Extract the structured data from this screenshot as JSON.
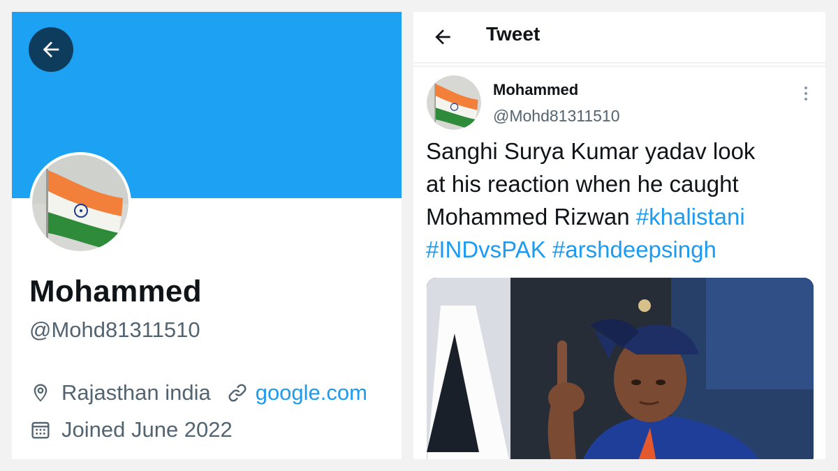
{
  "profile": {
    "display_name": "Mohammed",
    "handle": "@Mohd81311510",
    "location": "Rajasthan india",
    "website": "google.com",
    "joined": "Joined June 2022",
    "banner_color": "#1da1f2",
    "icons": {
      "back": "arrow-left-icon",
      "location": "location-pin-icon",
      "link": "link-icon",
      "calendar": "calendar-icon"
    }
  },
  "tweet": {
    "header_title": "Tweet",
    "author_name": "Mohammed",
    "author_handle": "@Mohd81311510",
    "text_parts": {
      "line1": "Sanghi Surya Kumar yadav look",
      "line2": "at his reaction when he caught",
      "line3_text": "Mohammed Rizwan ",
      "hashtag1": "#khalistani",
      "hashtag2": "#INDvsPAK",
      "hashtag3": "#arshdeepsingh"
    },
    "link_color": "#1d9bf0",
    "media": "photo of cricket player raising one finger"
  }
}
